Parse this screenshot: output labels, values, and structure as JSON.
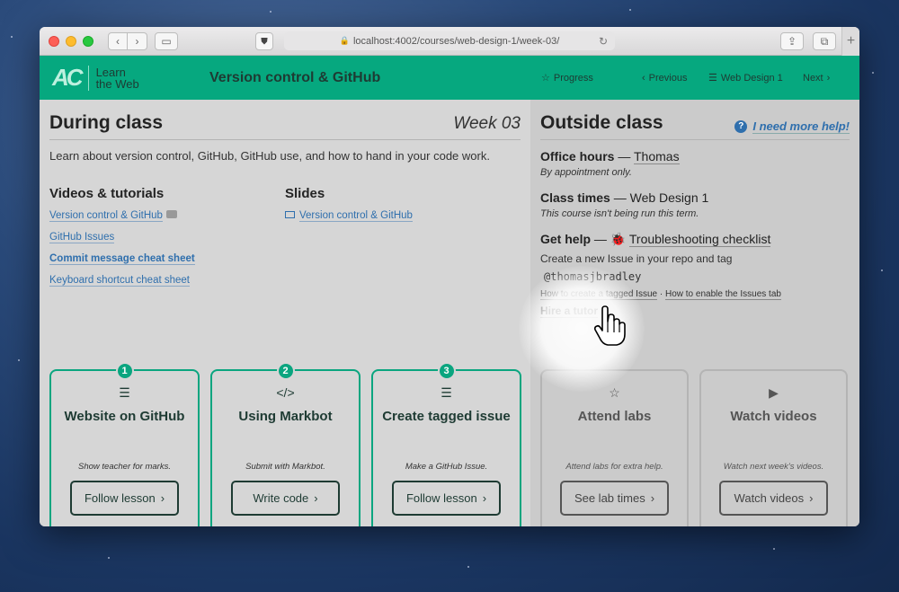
{
  "browser": {
    "url": "localhost:4002/courses/web-design-1/week-03/",
    "plus_label": "+"
  },
  "topnav": {
    "logo_mark": "AC",
    "logo_line1": "Learn",
    "logo_line2": "the Web",
    "course_title": "Version control & GitHub",
    "progress_label": "Progress",
    "previous_label": "Previous",
    "course_label": "Web Design 1",
    "next_label": "Next"
  },
  "during": {
    "title": "During class",
    "week": "Week 03",
    "intro": "Learn about version control, GitHub, GitHub use, and how to hand in your code work.",
    "videos_heading": "Videos & tutorials",
    "videos": [
      "Version control & GitHub",
      "GitHub Issues",
      "Commit message cheat sheet",
      "Keyboard shortcut cheat sheet"
    ],
    "slides_heading": "Slides",
    "slides": [
      "Version control & GitHub"
    ],
    "cards": [
      {
        "number": "1",
        "icon": "list-icon",
        "title": "Website on GitHub",
        "sub": "Show teacher for marks.",
        "button": "Follow lesson"
      },
      {
        "number": "2",
        "icon": "code-icon",
        "title": "Using Markbot",
        "sub": "Submit with Markbot.",
        "button": "Write code"
      },
      {
        "number": "3",
        "icon": "list-icon",
        "title": "Create tagged issue",
        "sub": "Make a GitHub Issue.",
        "button": "Follow lesson"
      }
    ]
  },
  "outside": {
    "title": "Outside class",
    "help_link": "I need more help!",
    "office_label": "Office hours",
    "office_value": "Thomas",
    "office_sub": "By appointment only.",
    "class_label": "Class times",
    "class_value": "Web Design 1",
    "class_sub": "This course isn't being run this term.",
    "help_label": "Get help",
    "help_value": "Troubleshooting checklist",
    "help_text": "Create a new Issue in your repo and tag",
    "help_code": "@thomasjbradley",
    "link_issue": "How to create a tagged Issue",
    "link_sep": "·",
    "link_enable": "How to enable the Issues tab",
    "hire": "Hire a tutor",
    "cards": [
      {
        "icon": "star-icon",
        "title": "Attend labs",
        "sub": "Attend labs for extra help.",
        "button": "See lab times"
      },
      {
        "icon": "video-icon",
        "title": "Watch videos",
        "sub": "Watch next week's videos.",
        "button": "Watch videos"
      }
    ]
  }
}
